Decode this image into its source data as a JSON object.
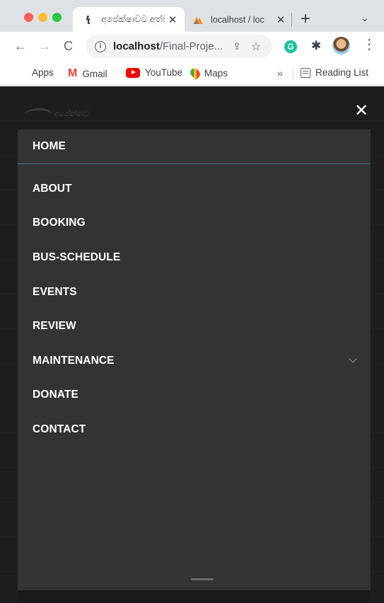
{
  "browser": {
    "tabs": [
      {
        "title": "අපේක්ෂාවට අත්ව",
        "active": true
      },
      {
        "title": "localhost / loc",
        "active": false
      }
    ],
    "tab_close_glyph": "✕",
    "new_tab_glyph": "+",
    "tab_menu_glyph": "⌄",
    "address": {
      "host": "localhost",
      "path": "/Final-Proje..."
    },
    "nav_glyphs": {
      "back": "←",
      "forward": "→",
      "reload": "C"
    },
    "toolbar_glyphs": {
      "share": "⇪",
      "star": "☆",
      "grammarly": "G",
      "extensions": "✱",
      "menu": "⋮",
      "info": "i"
    },
    "bookmarks": [
      {
        "label": "Apps",
        "icon": "apps-grid-icon"
      },
      {
        "label": "Gmail",
        "icon": "gmail-icon"
      },
      {
        "label": "YouTube",
        "icon": "youtube-icon"
      },
      {
        "label": "Maps",
        "icon": "maps-icon"
      }
    ],
    "bookmarks_overflow": "»",
    "reading_list": "Reading List"
  },
  "page": {
    "logo_text": "අපේක්ෂාව",
    "close_glyph": "✕",
    "menu": [
      {
        "label": "HOME",
        "active": true,
        "has_submenu": false
      },
      {
        "label": "ABOUT",
        "active": false,
        "has_submenu": false
      },
      {
        "label": "BOOKING",
        "active": false,
        "has_submenu": false
      },
      {
        "label": "BUS-SCHEDULE",
        "active": false,
        "has_submenu": false
      },
      {
        "label": "EVENTS",
        "active": false,
        "has_submenu": false
      },
      {
        "label": "REVIEW",
        "active": false,
        "has_submenu": false
      },
      {
        "label": "MAINTENANCE",
        "active": false,
        "has_submenu": true
      },
      {
        "label": "DONATE",
        "active": false,
        "has_submenu": false
      },
      {
        "label": "CONTACT",
        "active": false,
        "has_submenu": false
      }
    ]
  },
  "colors": {
    "page_bg": "#1c1c1e",
    "menu_panel_bg": "#333334",
    "active_underline": "#3f6f8a",
    "menu_text": "#ffffff"
  }
}
